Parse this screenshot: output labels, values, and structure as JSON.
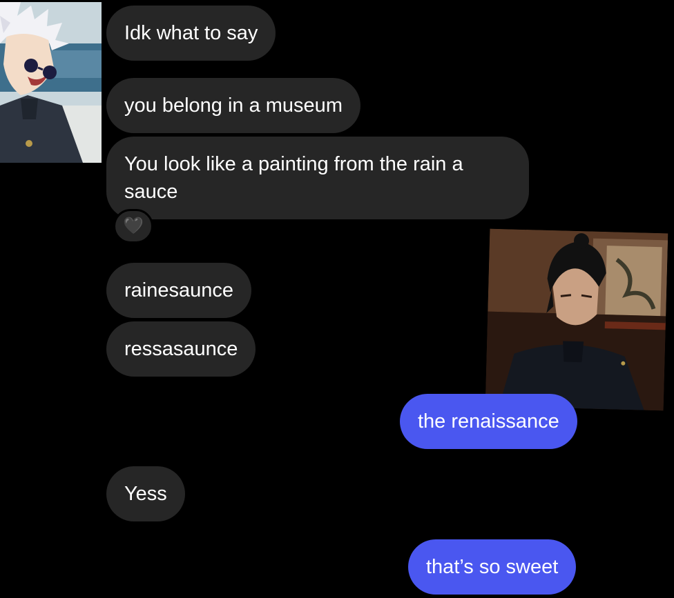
{
  "messages": [
    {
      "id": "m1",
      "direction": "incoming",
      "text": "Idk what to say"
    },
    {
      "id": "m2",
      "direction": "incoming",
      "text": "you belong in a museum"
    },
    {
      "id": "m3",
      "direction": "incoming",
      "text": "You look like a painting from the rain a sauce"
    },
    {
      "id": "m4",
      "direction": "incoming",
      "text": "rainesaunce"
    },
    {
      "id": "m5",
      "direction": "incoming",
      "text": "ressasaunce"
    },
    {
      "id": "m6",
      "direction": "outgoing",
      "text": "the renaissance"
    },
    {
      "id": "m7",
      "direction": "incoming",
      "text": "Yess"
    },
    {
      "id": "m8",
      "direction": "outgoing",
      "text": "that’s so sweet"
    }
  ],
  "reaction": {
    "icon": "black-heart-icon",
    "glyph": "🖤",
    "on_message": "m3"
  },
  "stickers": [
    {
      "name": "white-haired-character-avatar",
      "icon": "anime-character-white-hair-sunglasses"
    },
    {
      "name": "dark-haired-character-avatar",
      "icon": "anime-character-dark-hair-bun"
    }
  ],
  "colors": {
    "background": "#000000",
    "incoming_bubble": "#262626",
    "outgoing_bubble": "#4a57f0",
    "text": "#ffffff"
  }
}
